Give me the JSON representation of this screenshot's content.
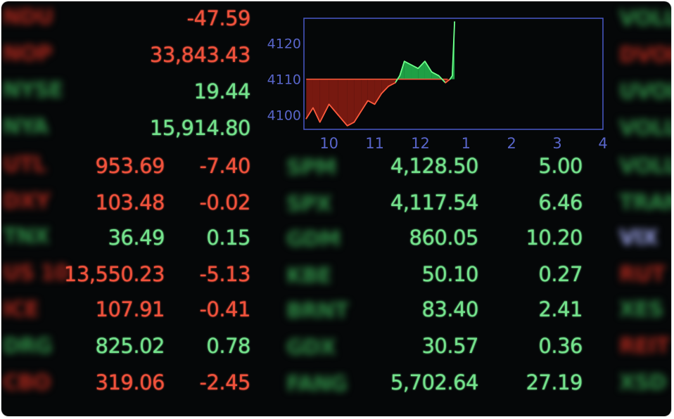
{
  "left_symbols": [
    {
      "text": "NDU",
      "tone": "red"
    },
    {
      "text": "NOP",
      "tone": "red"
    },
    {
      "text": "NYSE",
      "tone": "green"
    },
    {
      "text": "NYA",
      "tone": "green"
    },
    {
      "text": "UTL",
      "tone": "red"
    },
    {
      "text": "DXY",
      "tone": "red"
    },
    {
      "text": "TNX",
      "tone": "green"
    },
    {
      "text": "US 10",
      "tone": "red"
    },
    {
      "text": "ICE",
      "tone": "red"
    },
    {
      "text": "DRG",
      "tone": "green"
    },
    {
      "text": "CBO",
      "tone": "red"
    }
  ],
  "top_values": [
    {
      "value": "-47.59",
      "tone": "red"
    },
    {
      "value": "33,843.43",
      "tone": "red"
    },
    {
      "value": "19.44",
      "tone": "green"
    },
    {
      "value": "15,914.80",
      "tone": "green"
    }
  ],
  "left_rows": [
    {
      "price": "953.69",
      "change": "-7.40",
      "tone": "red"
    },
    {
      "price": "103.48",
      "change": "-0.02",
      "tone": "red"
    },
    {
      "price": "36.49",
      "change": "0.15",
      "tone": "green"
    },
    {
      "price": "13,550.23",
      "change": "-5.13",
      "tone": "red"
    },
    {
      "price": "107.91",
      "change": "-0.41",
      "tone": "red"
    },
    {
      "price": "825.02",
      "change": "0.78",
      "tone": "green"
    },
    {
      "price": "319.06",
      "change": "-2.45",
      "tone": "red"
    }
  ],
  "mid_symbols": [
    "SPM",
    "SPX",
    "GDM",
    "KBE",
    "BRNT",
    "GDX",
    "FANG"
  ],
  "right_rows": [
    {
      "price": "4,128.50",
      "change": "5.00"
    },
    {
      "price": "4,117.54",
      "change": "6.46"
    },
    {
      "price": "860.05",
      "change": "10.20"
    },
    {
      "price": "50.10",
      "change": "0.27"
    },
    {
      "price": "83.40",
      "change": "2.41"
    },
    {
      "price": "30.57",
      "change": "0.36"
    },
    {
      "price": "5,702.64",
      "change": "27.19"
    }
  ],
  "far_right_symbols": [
    {
      "text": "VOLU",
      "tone": "green"
    },
    {
      "text": "DVOL",
      "tone": "red"
    },
    {
      "text": "UVOL",
      "tone": "green"
    },
    {
      "text": "VOLU",
      "tone": "green"
    },
    {
      "text": "VOLU",
      "tone": "green"
    },
    {
      "text": "TRAN",
      "tone": "green"
    },
    {
      "text": "VIX",
      "tone": "blue"
    },
    {
      "text": "RUT",
      "tone": "red"
    },
    {
      "text": "XES",
      "tone": "green"
    },
    {
      "text": "REIT",
      "tone": "red"
    },
    {
      "text": "XSD",
      "tone": "green"
    }
  ],
  "chart_data": {
    "type": "line",
    "x_ticks": [
      "10",
      "11",
      "12",
      "1",
      "2",
      "3",
      "4"
    ],
    "y_ticks": [
      "4100",
      "4110",
      "4120"
    ],
    "ylim": [
      4096,
      4127
    ],
    "baseline": 4110,
    "x": [
      9.5,
      9.65,
      9.8,
      10.0,
      10.2,
      10.4,
      10.55,
      10.7,
      10.85,
      11.0,
      11.15,
      11.3,
      11.45,
      11.55,
      11.65,
      11.8,
      11.95,
      12.1,
      12.25,
      12.4,
      12.55,
      12.65,
      12.7,
      12.75
    ],
    "values": [
      4099,
      4102,
      4098,
      4103,
      4100,
      4097,
      4098,
      4101,
      4104,
      4103,
      4106,
      4108,
      4109,
      4111,
      4115,
      4114,
      4113,
      4115,
      4112,
      4111,
      4109,
      4110,
      4111,
      4126
    ],
    "colors": {
      "above": "#22b14c",
      "below": "#8c1c12",
      "line_below": "#ff5b3d",
      "line_above": "#6dff8a",
      "axis": "#4a58c8"
    },
    "grid": false
  },
  "colors": {
    "background": "#050708",
    "red": "#f0523c",
    "green": "#74e28c"
  }
}
